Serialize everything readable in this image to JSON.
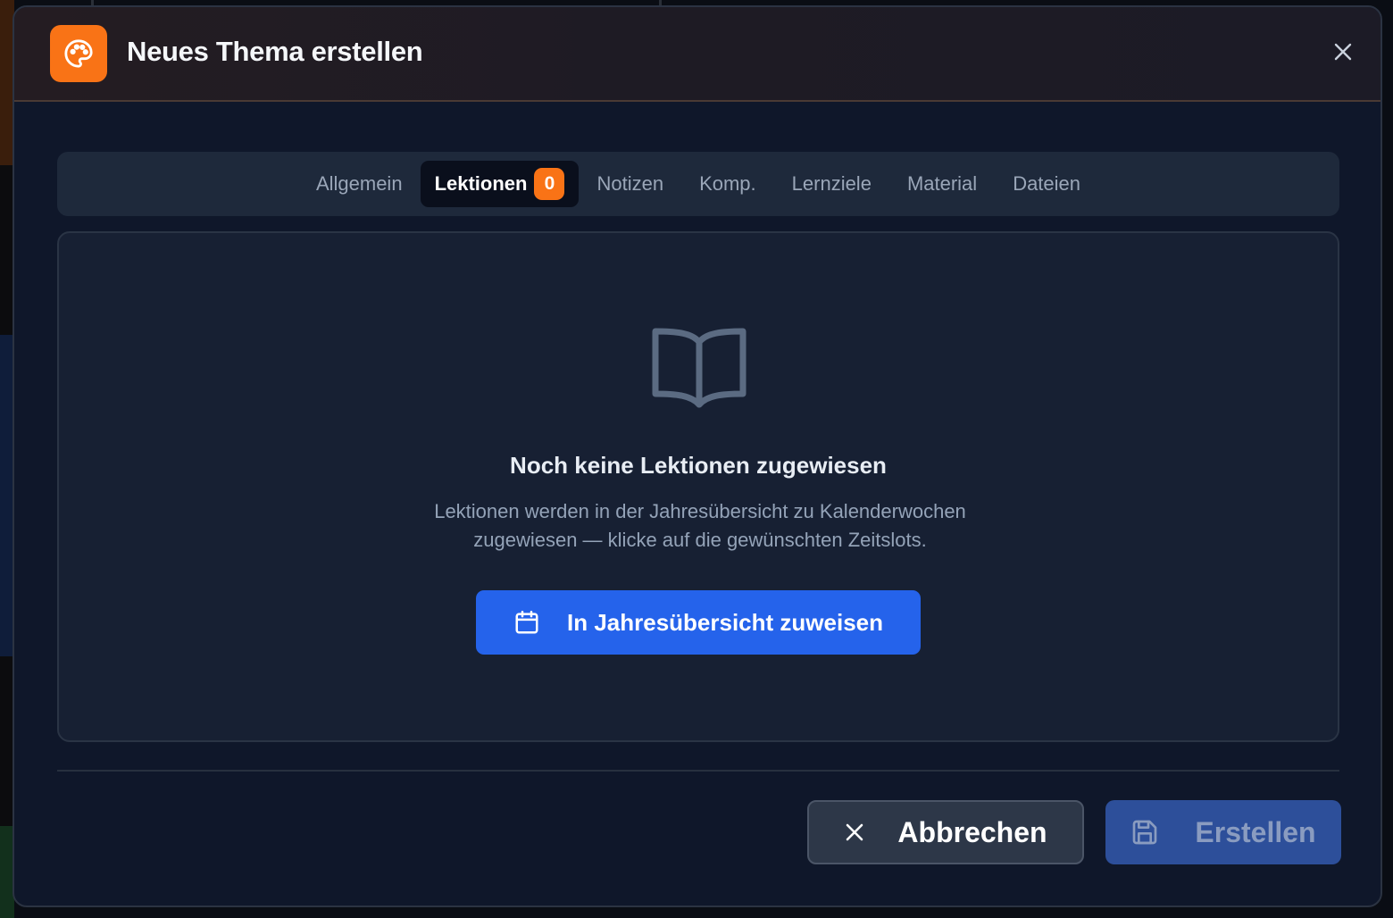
{
  "dialog": {
    "title": "Neues Thema erstellen",
    "icon": "palette-icon",
    "accent_color": "#f97316"
  },
  "tabs": [
    {
      "label": "Allgemein",
      "active": false
    },
    {
      "label": "Lektionen",
      "active": true,
      "badge": "0"
    },
    {
      "label": "Notizen",
      "active": false
    },
    {
      "label": "Komp.",
      "active": false
    },
    {
      "label": "Lernziele",
      "active": false
    },
    {
      "label": "Material",
      "active": false
    },
    {
      "label": "Dateien",
      "active": false
    }
  ],
  "empty_state": {
    "icon": "book-open-icon",
    "title": "Noch keine Lektionen zugewiesen",
    "description": "Lektionen werden in der Jahresübersicht zu Kalenderwochen zugewiesen — klicke auf die gewünschten Zeitslots.",
    "action_label": "In Jahresübersicht zuweisen",
    "action_icon": "calendar-icon",
    "action_color": "#2563eb"
  },
  "footer": {
    "cancel_label": "Abbrechen",
    "create_label": "Erstellen",
    "create_disabled": true
  }
}
